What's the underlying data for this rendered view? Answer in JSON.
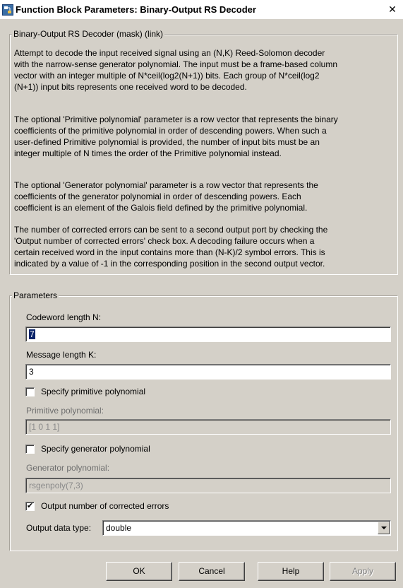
{
  "window": {
    "title": "Function Block Parameters: Binary-Output RS Decoder",
    "close_glyph": "✕"
  },
  "mask_group": {
    "label": "Binary-Output RS Decoder (mask) (link)",
    "paragraphs": [
      [
        "Attempt to decode the input received signal using an (N,K) Reed-Solomon decoder",
        "with the narrow-sense generator polynomial.  The input must be a frame-based column",
        "vector with an integer multiple of N*ceil(log2(N+1)) bits.  Each group of N*ceil(log2",
        "(N+1)) input bits represents one received word to be decoded."
      ],
      [
        "The optional 'Primitive polynomial' parameter is a row vector that represents the binary",
        "coefficients of the primitive polynomial in order of descending powers.  When such a",
        "user-defined Primitive polynomial is provided, the number of input bits must be an",
        "integer multiple of N times the order of the Primitive polynomial instead."
      ],
      [
        "The optional 'Generator polynomial' parameter is a row vector that represents the",
        "coefficients of the generator polynomial in order of descending powers.  Each",
        "coefficient is an element of the Galois field defined by the primitive polynomial."
      ],
      [
        "The number of corrected errors can be sent to a second output port by checking the",
        "'Output number of corrected errors' check box.  A decoding failure occurs when a",
        "certain received word in the input contains more than (N-K)/2 symbol errors.  This is",
        "indicated by a value of -1 in the corresponding position in the second output vector."
      ]
    ]
  },
  "parameters": {
    "label": "Parameters",
    "codeword_length": {
      "label": "Codeword length N:",
      "value": "7"
    },
    "message_length": {
      "label": "Message length K:",
      "value": "3"
    },
    "specify_primitive": {
      "label": "Specify primitive polynomial",
      "checked": false
    },
    "primitive_poly": {
      "label": "Primitive polynomial:",
      "value": "[1 0 1 1]"
    },
    "specify_generator": {
      "label": "Specify generator polynomial",
      "checked": false
    },
    "generator_poly": {
      "label": "Generator polynomial:",
      "value": "rsgenpoly(7,3)"
    },
    "output_corrected": {
      "label": "Output number of corrected errors",
      "checked": true,
      "mark": "✔"
    },
    "output_data_type": {
      "label": "Output data type:",
      "value": "double"
    }
  },
  "buttons": {
    "ok": "OK",
    "cancel": "Cancel",
    "help": "Help",
    "apply": "Apply"
  },
  "icons": {
    "title_icon": "simulink-block-icon",
    "close": "close-icon"
  }
}
